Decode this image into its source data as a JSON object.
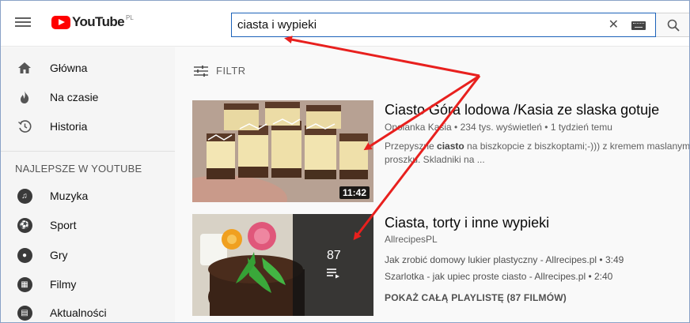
{
  "header": {
    "logo_text": "YouTube",
    "logo_region": "PL",
    "search_value": "ciasta i wypieki",
    "clear_symbol": "✕"
  },
  "sidebar": {
    "items": [
      {
        "label": "Główna",
        "icon": "home-icon"
      },
      {
        "label": "Na czasie",
        "icon": "flame-icon"
      },
      {
        "label": "Historia",
        "icon": "history-icon"
      }
    ],
    "section_title": "NAJLEPSZE W YOUTUBE",
    "best_items": [
      {
        "label": "Muzyka",
        "icon": "music-icon"
      },
      {
        "label": "Sport",
        "icon": "sport-icon"
      },
      {
        "label": "Gry",
        "icon": "games-icon"
      },
      {
        "label": "Filmy",
        "icon": "film-icon"
      },
      {
        "label": "Aktualności",
        "icon": "news-icon"
      }
    ]
  },
  "filter": {
    "label": "FILTR",
    "icon": "filter-icon"
  },
  "results": [
    {
      "title": "Ciasto Góra lodowa /Kasia ze slaska gotuje",
      "meta": "Opolanka Kasia • 234 tys. wyświetleń • 1 tydzień temu",
      "desc_pre": "Przepyszne ",
      "desc_bold": "ciasto",
      "desc_post": " na biszkopcie z biszkoptami;-))) z kremem maslanym",
      "desc_line2": "proszku. Skladniki na ...",
      "duration": "11:42"
    },
    {
      "title": "Ciasta, torty i inne wypieki",
      "channel": "AllrecipesPL",
      "playlist_count": "87",
      "playlist_items": [
        "Jak zrobić domowy lukier plastyczny - Allrecipes.pl • 3:49",
        "Szarlotka - jak upiec proste ciasto - Allrecipes.pl • 2:40"
      ],
      "view_all": "POKAŻ CAŁĄ PLAYLISTĘ (87 FILMÓW)"
    }
  ],
  "colors": {
    "accent": "#ff0000",
    "annotation_arrow": "#e8201e",
    "search_border": "#1c62b9"
  }
}
